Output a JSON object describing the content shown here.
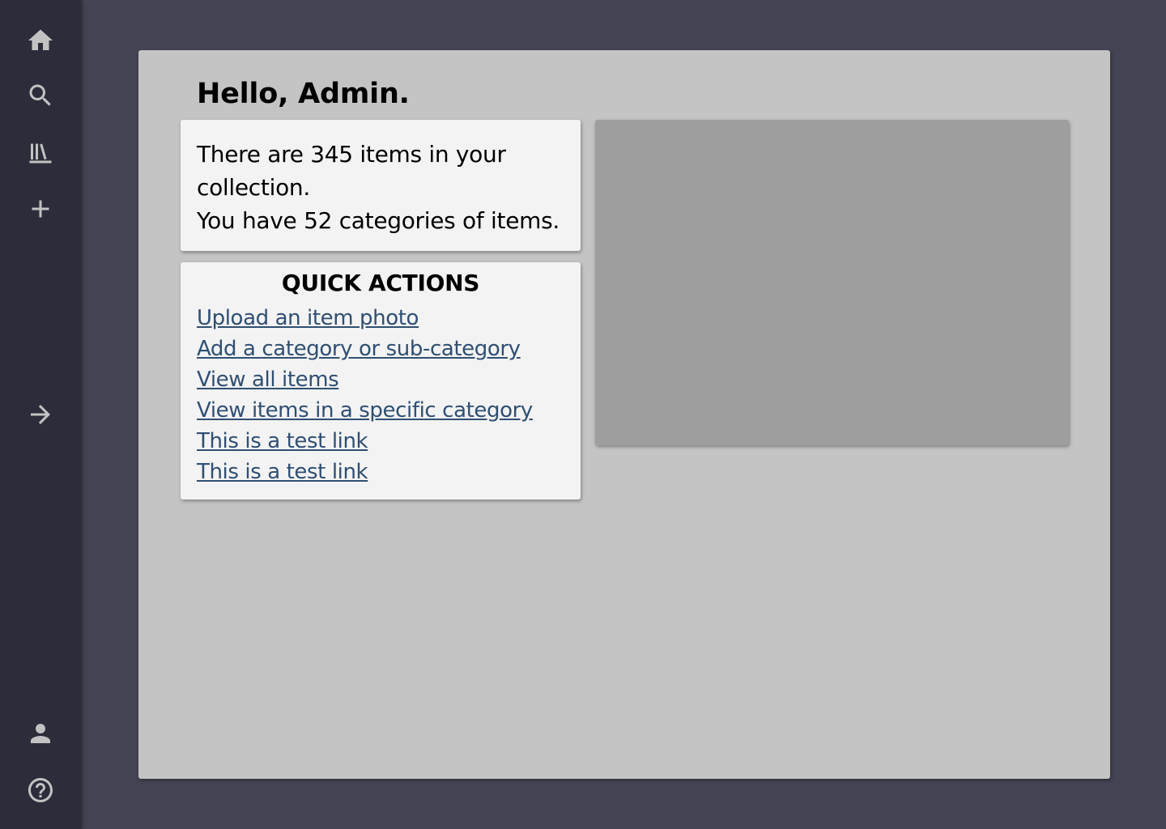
{
  "sidebar": {
    "top_items": [
      {
        "icon": "home-icon",
        "label": "Home"
      },
      {
        "icon": "search-icon",
        "label": "Search"
      },
      {
        "icon": "library-icon",
        "label": "Collection"
      },
      {
        "icon": "plus-icon",
        "label": "Add"
      }
    ],
    "middle_items": [
      {
        "icon": "arrow-right-icon",
        "label": "Expand"
      }
    ],
    "bottom_items": [
      {
        "icon": "user-icon",
        "label": "Account"
      },
      {
        "icon": "help-icon",
        "label": "Help"
      }
    ]
  },
  "main": {
    "greeting": "Hello, Admin.",
    "stats": {
      "line1": "There are 345 items in your collection.",
      "line2": "You have 52 categories of items."
    },
    "quick_actions": {
      "title": "QUICK ACTIONS",
      "links": [
        "Upload an item photo",
        "Add a category or sub-category",
        "View all items",
        "View items in a specific category",
        "This is a test link",
        "This is a test link"
      ]
    }
  },
  "colors": {
    "background": "#434454",
    "sidebar": "#2c2d3a",
    "icon": "#c2c2c2",
    "panel": "#c4c4c4",
    "card": "#f3f3f3",
    "link": "#2f4f73",
    "placeholder": "#9e9e9e"
  }
}
